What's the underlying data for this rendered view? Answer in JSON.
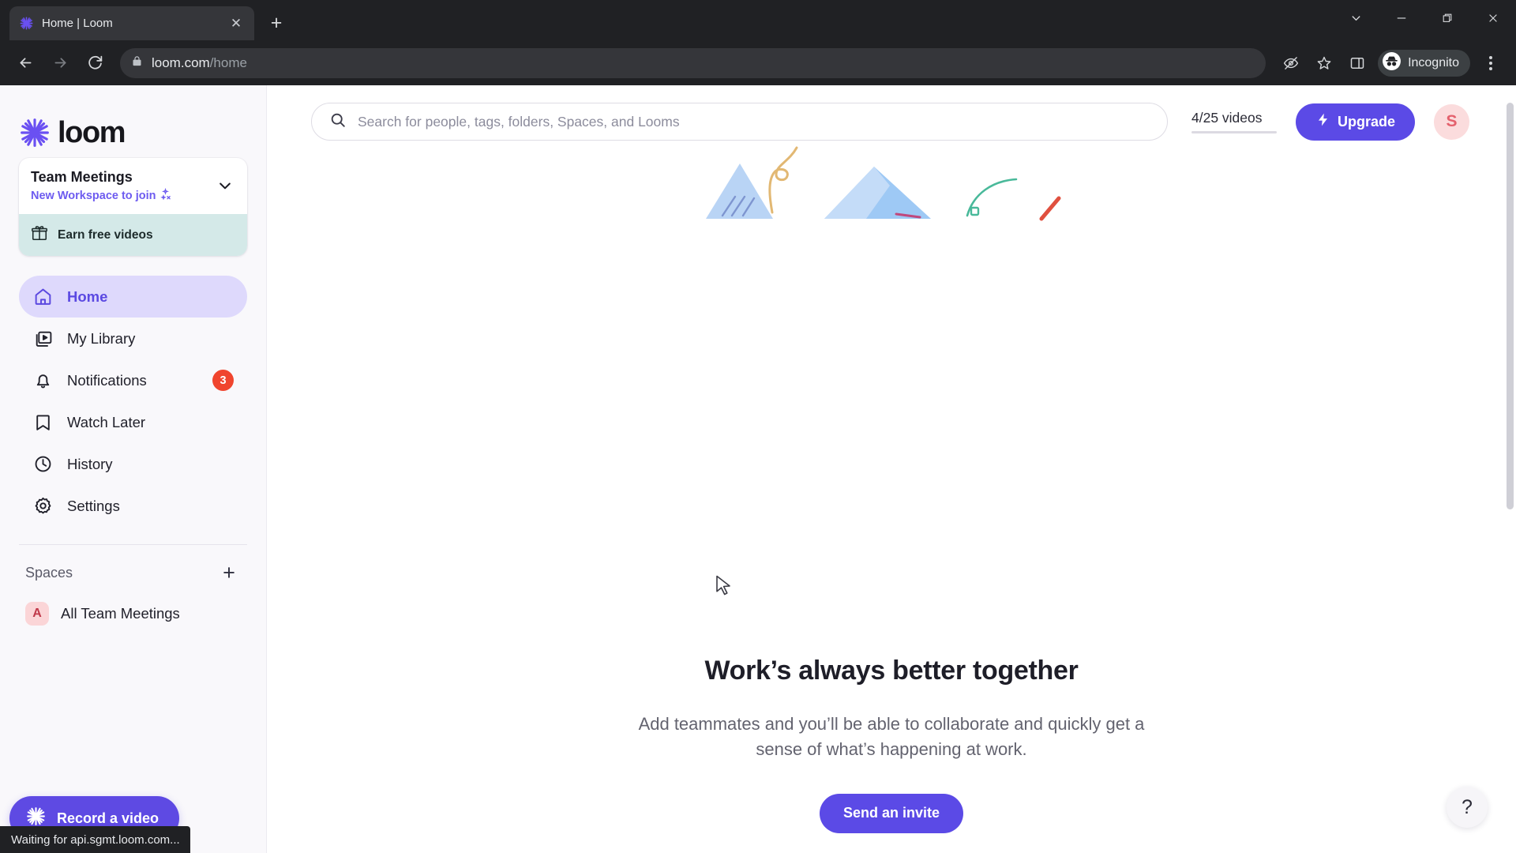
{
  "browser": {
    "tab": {
      "title": "Home | Loom",
      "favicon_icon": "loom-logo-icon",
      "close_icon": "close-icon"
    },
    "new_tab_icon": "plus-icon",
    "window_controls": [
      {
        "name": "tab-search",
        "icon": "chevron-down-icon"
      },
      {
        "name": "minimize",
        "icon": "minimize-icon"
      },
      {
        "name": "maximize",
        "icon": "maximize-icon"
      },
      {
        "name": "close",
        "icon": "close-icon"
      }
    ],
    "nav": {
      "back_icon": "arrow-left-icon",
      "forward_icon": "arrow-right-icon",
      "reload_icon": "reload-icon"
    },
    "omnibox": {
      "lock_icon": "lock-icon",
      "domain": "loom.com",
      "path": "/home"
    },
    "toolbar_icons": [
      {
        "name": "eye-off-icon"
      },
      {
        "name": "bookmark-star-icon"
      },
      {
        "name": "side-panel-icon"
      }
    ],
    "incognito": {
      "label": "Incognito",
      "icon": "incognito-icon"
    },
    "menu_icon": "kebab-menu-icon",
    "status_text": "Waiting for api.sgmt.loom.com..."
  },
  "sidebar": {
    "logo": {
      "text": "loom",
      "icon": "loom-starburst-icon"
    },
    "workspace": {
      "name": "Team Meetings",
      "subtitle": "New Workspace to join",
      "subtitle_icon": "sparkle-person-icon",
      "chevron_icon": "chevron-down-icon",
      "earn": {
        "label": "Earn free videos",
        "icon": "gift-icon"
      }
    },
    "nav_items": [
      {
        "label": "Home",
        "icon": "home-icon",
        "active": true,
        "badge": ""
      },
      {
        "label": "My Library",
        "icon": "library-video-icon",
        "active": false,
        "badge": ""
      },
      {
        "label": "Notifications",
        "icon": "bell-icon",
        "active": false,
        "badge": "3"
      },
      {
        "label": "Watch Later",
        "icon": "bookmark-icon",
        "active": false,
        "badge": ""
      },
      {
        "label": "History",
        "icon": "clock-icon",
        "active": false,
        "badge": ""
      },
      {
        "label": "Settings",
        "icon": "gear-icon",
        "active": false,
        "badge": ""
      }
    ],
    "spaces": {
      "title": "Spaces",
      "add_icon": "plus-icon",
      "items": [
        {
          "label": "All Team Meetings",
          "avatar_letter": "A"
        }
      ]
    },
    "record_button": {
      "label": "Record a video",
      "icon": "loom-starburst-icon"
    }
  },
  "header": {
    "search": {
      "placeholder": "Search for people, tags, folders, Spaces, and Looms",
      "value": "",
      "icon": "search-icon"
    },
    "quota": {
      "text": "4/25 videos",
      "used": 4,
      "total": 25,
      "percent": 16
    },
    "upgrade": {
      "label": "Upgrade",
      "icon": "lightning-bolt-icon"
    },
    "avatar": {
      "letter": "S"
    }
  },
  "main": {
    "illustration_name": "mountains-doodle-illustration",
    "empty_state": {
      "title": "Work’s always better together",
      "description": "Add teammates and you’ll be able to collaborate and quickly get a sense of what’s happening at work.",
      "cta_label": "Send an invite"
    },
    "help_button": {
      "label": "?",
      "icon": "question-mark-icon"
    }
  },
  "colors": {
    "brand_purple": "#5b4ae6",
    "active_nav_bg": "#ded9fc",
    "badge_red": "#f0452e",
    "earn_mint": "#d4e9e8",
    "sidebar_bg": "#f9f8fb",
    "avatar_pink": "#fbdcdd"
  }
}
